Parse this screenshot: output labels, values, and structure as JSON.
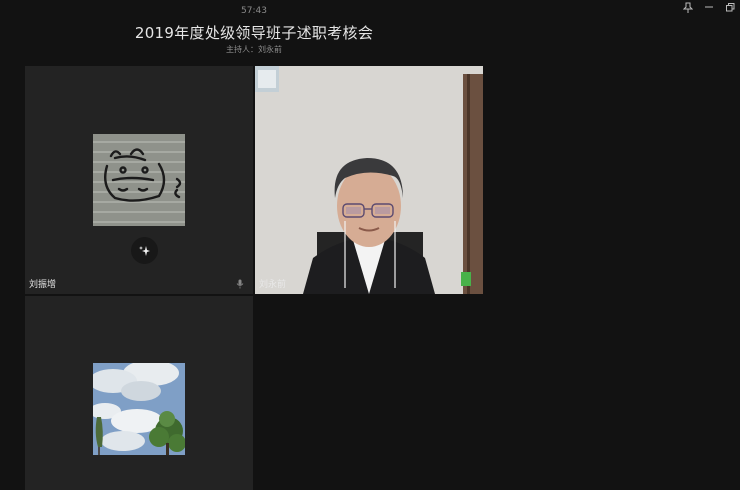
{
  "header": {
    "timer": "57:43",
    "title": "2019年度处级领导班子述职考核会",
    "host": "主持人：刘永前"
  },
  "window_controls": [
    "pin-icon",
    "minimize-icon",
    "restore-icon"
  ],
  "participants": [
    {
      "name": "刘振增",
      "view": "avatar-cow-drawing",
      "effects_button": "sparkle-icon",
      "mic": "mic-icon"
    },
    {
      "name": "刘永前",
      "view": "camera-video"
    },
    {
      "name": "",
      "view": "avatar-sky-tree"
    }
  ],
  "colors": {
    "background": "#121212",
    "tile": "#232323",
    "text": "#e6e6e6"
  }
}
